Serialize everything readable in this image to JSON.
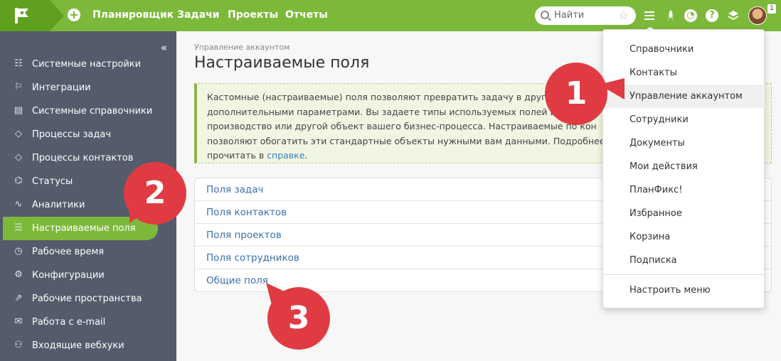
{
  "topbar": {
    "nav": [
      "Планировщик",
      "Задачи",
      "Проекты",
      "Отчеты"
    ],
    "search_placeholder": "Найти",
    "icons": [
      "flag-logo-icon",
      "add-icon",
      "search-icon",
      "star-icon",
      "menu-icon",
      "rocket-icon",
      "clock-icon",
      "help-icon",
      "layers-icon"
    ],
    "badge": "1"
  },
  "sidebar": {
    "collapse": "«",
    "items": [
      {
        "label": "Системные настройки",
        "icon": "☷"
      },
      {
        "label": "Интеграции",
        "icon": "⚐"
      },
      {
        "label": "Системные справочники",
        "icon": "▤"
      },
      {
        "label": "Процессы задач",
        "icon": "◇"
      },
      {
        "label": "Процессы контактов",
        "icon": "◇"
      },
      {
        "label": "Статусы",
        "icon": "⌬"
      },
      {
        "label": "Аналитики",
        "icon": "∿"
      },
      {
        "label": "Настраиваемые поля",
        "icon": "☰"
      },
      {
        "label": "Рабочее время",
        "icon": "◷"
      },
      {
        "label": "Конфигурации",
        "icon": "⚙"
      },
      {
        "label": "Рабочие пространства",
        "icon": "⇗"
      },
      {
        "label": "Работа с e-mail",
        "icon": "✉"
      },
      {
        "label": "Входящие вебхуки",
        "icon": "⚇"
      }
    ]
  },
  "main": {
    "breadcrumb": "Управление аккаунтом",
    "title": "Настраиваемые поля",
    "info": {
      "lines": [
        "Кастомные (настраиваемые) поля позволяют превратить задачу в другой",
        "дополнительными параметрами. Вы задаете типы используемых полей и",
        "производство или другой объект вашего бизнес-процесса. Настраиваемые по кон",
        "позволяют обогатить эти стандартные объекты нужными вам данными. Подробнее"
      ],
      "last_prefix": "прочитать в ",
      "link": "справке",
      "last_suffix": "."
    },
    "fields": [
      "Поля задач",
      "Поля контактов",
      "Поля проектов",
      "Поля сотрудников",
      "Общие поля"
    ]
  },
  "dropdown": {
    "items": [
      "Справочники",
      "Контакты",
      "Управление аккаунтом",
      "Сотрудники",
      "Документы",
      "Мои действия",
      "ПланФикс!",
      "Избранное",
      "Корзина",
      "Подписка"
    ],
    "footer": "Настроить меню"
  },
  "markers": [
    "1",
    "2",
    "3"
  ],
  "colors": {
    "brand": "#7cb93a",
    "sidebar": "#545b6b",
    "marker": "#e03b43",
    "link": "#3b6fb0"
  }
}
